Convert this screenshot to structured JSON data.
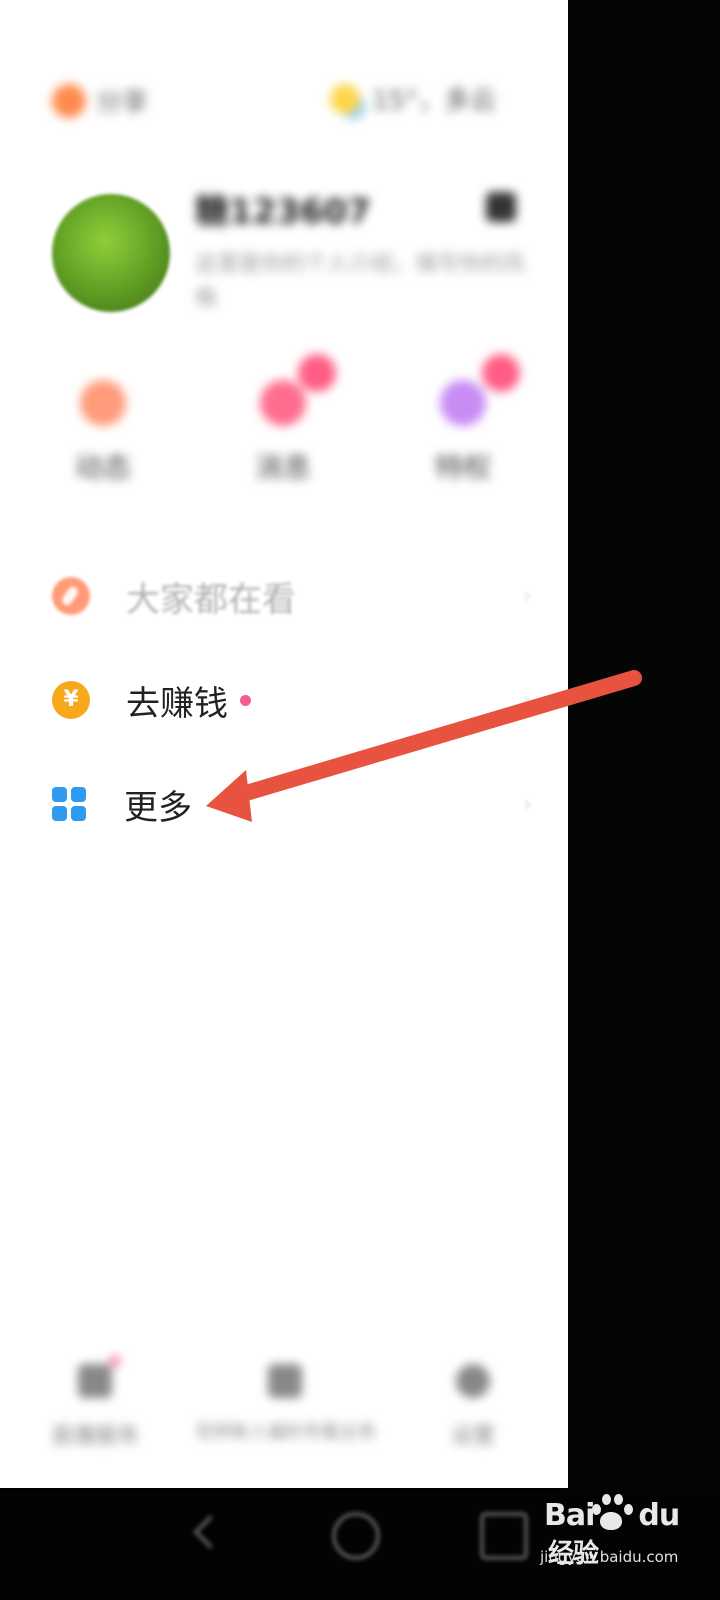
{
  "drawer": {
    "top_left_label": "分享",
    "weather_text": "15°，多云",
    "profile": {
      "username": "糖123607",
      "description": "这里是你的个人介绍，填写你的风格"
    },
    "stats": [
      {
        "label": "动态"
      },
      {
        "label": "消息"
      },
      {
        "label": "特权"
      }
    ],
    "menu": [
      {
        "label": "大家都在看",
        "icon": "compass-icon"
      },
      {
        "label": "去赚钱",
        "icon": "yen-coin-icon",
        "yen": "¥"
      },
      {
        "label": "更多",
        "icon": "grid-icon"
      }
    ],
    "bottom": [
      {
        "label": "直播服务"
      },
      {
        "label": "花样新人福利专属主场"
      },
      {
        "label": "设置"
      }
    ]
  },
  "watermark": {
    "logo_left": "Bai",
    "logo_right": "du",
    "brand_cn": "经验",
    "url": "jingyan.baidu.com"
  },
  "colors": {
    "arrow": "#e8533f",
    "yen_coin": "#f7a81c",
    "grid_icon": "#2f9bf0",
    "compass": "#ff7c4a",
    "badge_pink": "#ff5d85"
  }
}
